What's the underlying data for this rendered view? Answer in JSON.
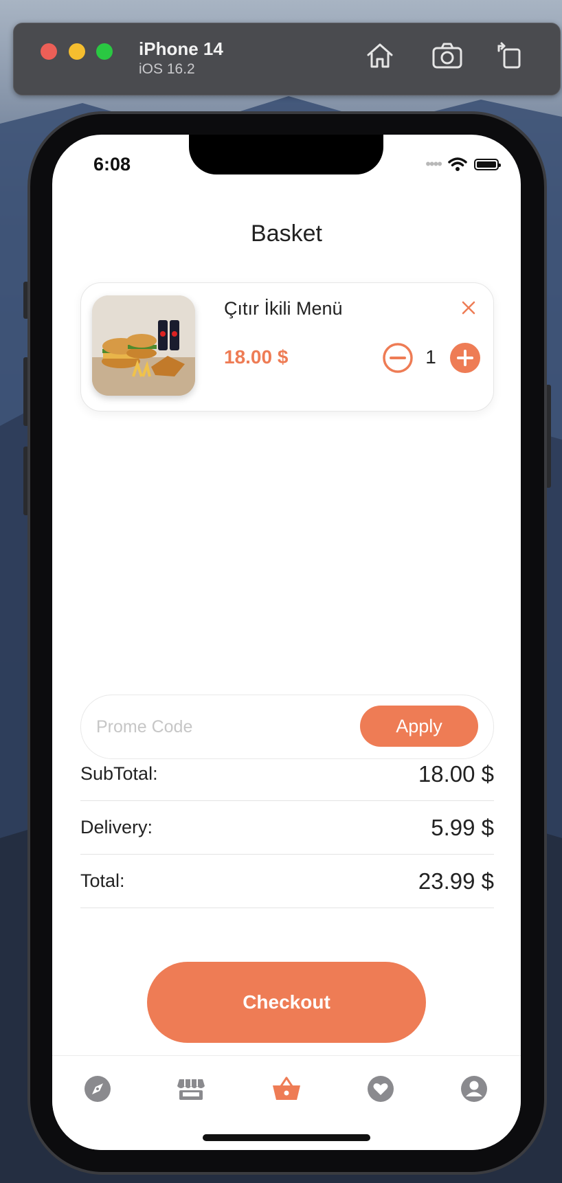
{
  "simulator": {
    "device_name": "iPhone 14",
    "os_version": "iOS 16.2",
    "toolbar_icons": [
      "home-icon",
      "screenshot-icon",
      "rotate-icon"
    ]
  },
  "status_bar": {
    "time": "6:08",
    "icons": [
      "signal-icon",
      "wifi-icon",
      "battery-icon"
    ]
  },
  "page": {
    "title": "Basket"
  },
  "cart_items": [
    {
      "name": "Çıtır İkili Menü",
      "price": "18.00 $",
      "quantity": "1",
      "image": "burger-menu-photo"
    }
  ],
  "promo": {
    "placeholder": "Prome Code",
    "value": "",
    "apply_label": "Apply"
  },
  "summary": {
    "subtotal_label": "SubTotal:",
    "subtotal_value": "18.00 $",
    "delivery_label": "Delivery:",
    "delivery_value": "5.99 $",
    "total_label": "Total:",
    "total_value": "23.99 $"
  },
  "checkout": {
    "label": "Checkout"
  },
  "tabbar": {
    "items": [
      {
        "icon": "compass-icon",
        "active": false
      },
      {
        "icon": "store-icon",
        "active": false
      },
      {
        "icon": "basket-icon",
        "active": true
      },
      {
        "icon": "heart-icon",
        "active": false
      },
      {
        "icon": "profile-icon",
        "active": false
      }
    ]
  },
  "colors": {
    "accent": "#ee7c55",
    "inactive_icon": "#8a8a8e",
    "text": "#222222"
  }
}
